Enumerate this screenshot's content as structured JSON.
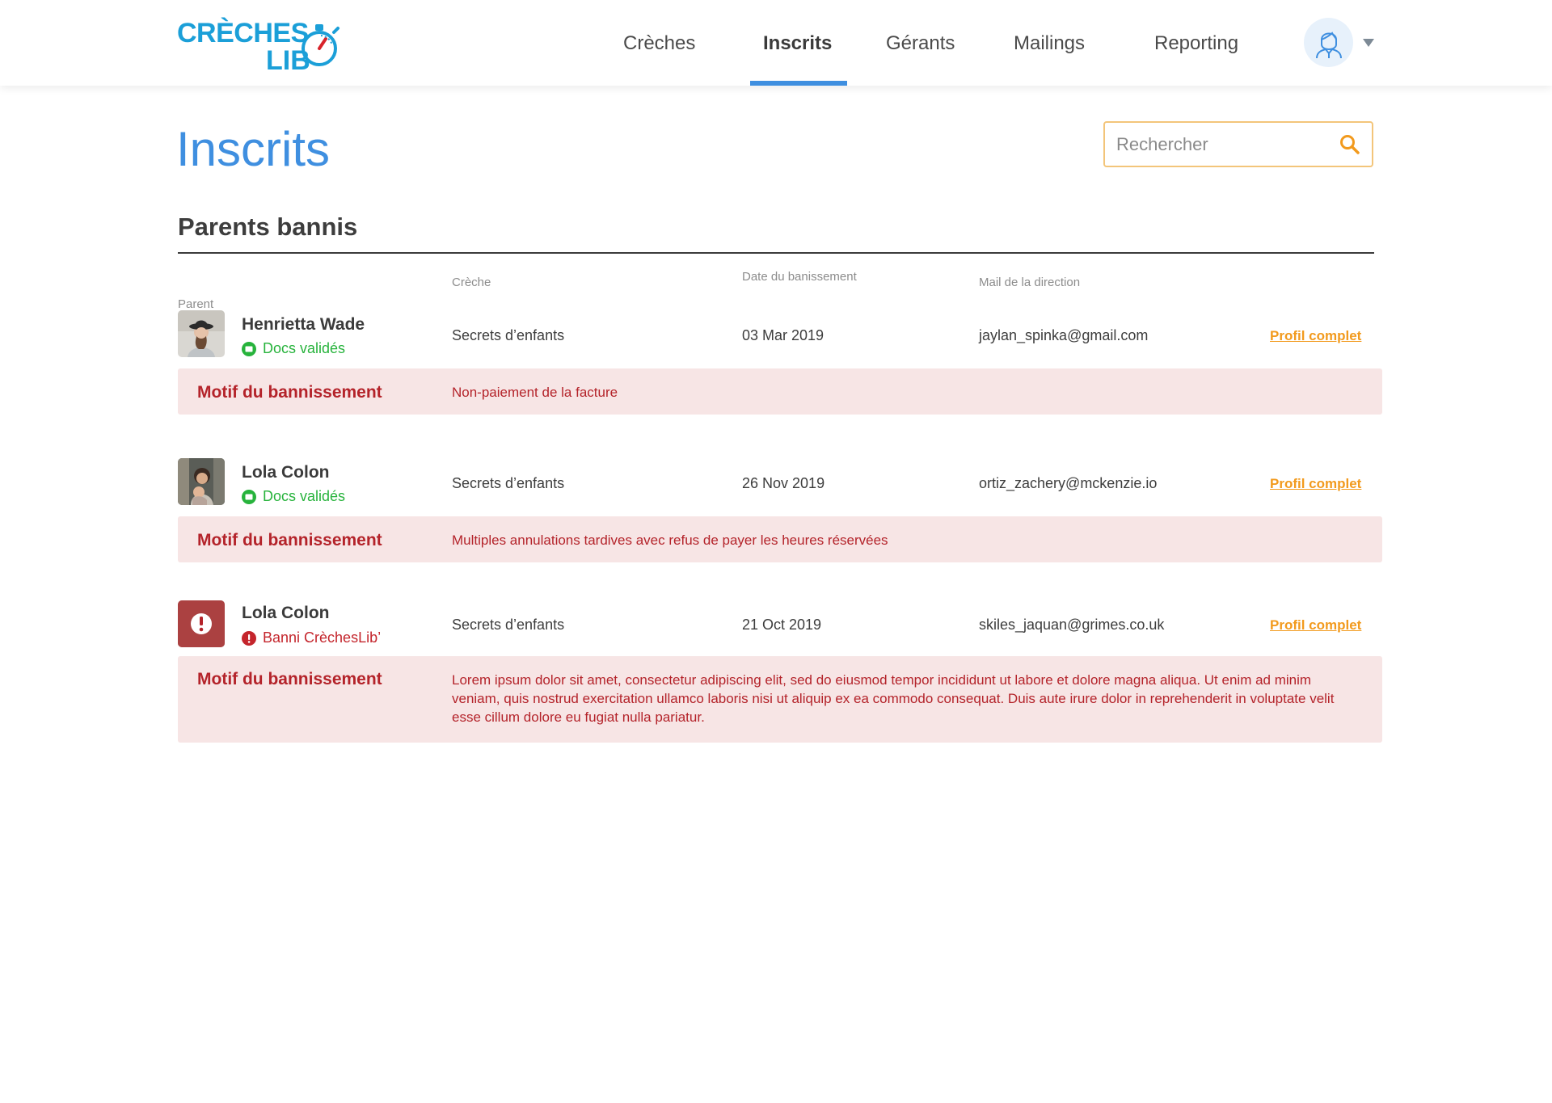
{
  "header": {
    "logo": {
      "line1": "CRÈCHES",
      "line2": "LIB"
    },
    "nav": [
      {
        "label": "Crèches",
        "active": false
      },
      {
        "label": "Inscrits",
        "active": true
      },
      {
        "label": "Gérants",
        "active": false
      },
      {
        "label": "Mailings",
        "active": false
      },
      {
        "label": "Reporting",
        "active": false
      }
    ],
    "user_icon": "user-avatar-icon"
  },
  "page": {
    "title": "Inscrits",
    "search_placeholder": "Rechercher",
    "section_title": "Parents bannis"
  },
  "table": {
    "headers": {
      "parent": "Parent",
      "creche": "Crèche",
      "date": "Date du banissement",
      "mail": "Mail de la direction"
    },
    "motif_label": "Motif du bannissement",
    "link_label": "Profil complet",
    "rows": [
      {
        "name": "Henrietta Wade",
        "status": "Docs validés",
        "status_type": "ok",
        "creche": "Secrets d’enfants",
        "date": "03 Mar 2019",
        "mail": "jaylan_spinka@gmail.com",
        "motif": "Non-paiement de la facture"
      },
      {
        "name": "Lola Colon",
        "status": "Docs validés",
        "status_type": "ok",
        "creche": "Secrets d’enfants",
        "date": "26 Nov 2019",
        "mail": "ortiz_zachery@mckenzie.io",
        "motif": "Multiples annulations tardives avec refus de payer les heures réservées"
      },
      {
        "name": "Lola Colon",
        "status": "Banni CrèchesLib’",
        "status_type": "banned",
        "creche": "Secrets d’enfants",
        "date": "21 Oct 2019",
        "mail": "skiles_jaquan@grimes.co.uk",
        "motif": "Lorem ipsum dolor sit amet, consectetur adipiscing elit, sed do eiusmod tempor incididunt ut labore et dolore magna aliqua. Ut enim ad minim veniam, quis nostrud exercitation ullamco laboris nisi ut aliquip ex ea commodo consequat. Duis aute irure dolor in reprehenderit in voluptate velit esse cillum dolore eu fugiat nulla pariatur."
      }
    ]
  },
  "colors": {
    "brand_blue": "#3f8fe0",
    "logo_blue": "#1b9fd8",
    "link_orange": "#f29a1d",
    "ban_red": "#b4232a",
    "ok_green": "#27b33c",
    "motif_bg": "#f7e5e5"
  }
}
